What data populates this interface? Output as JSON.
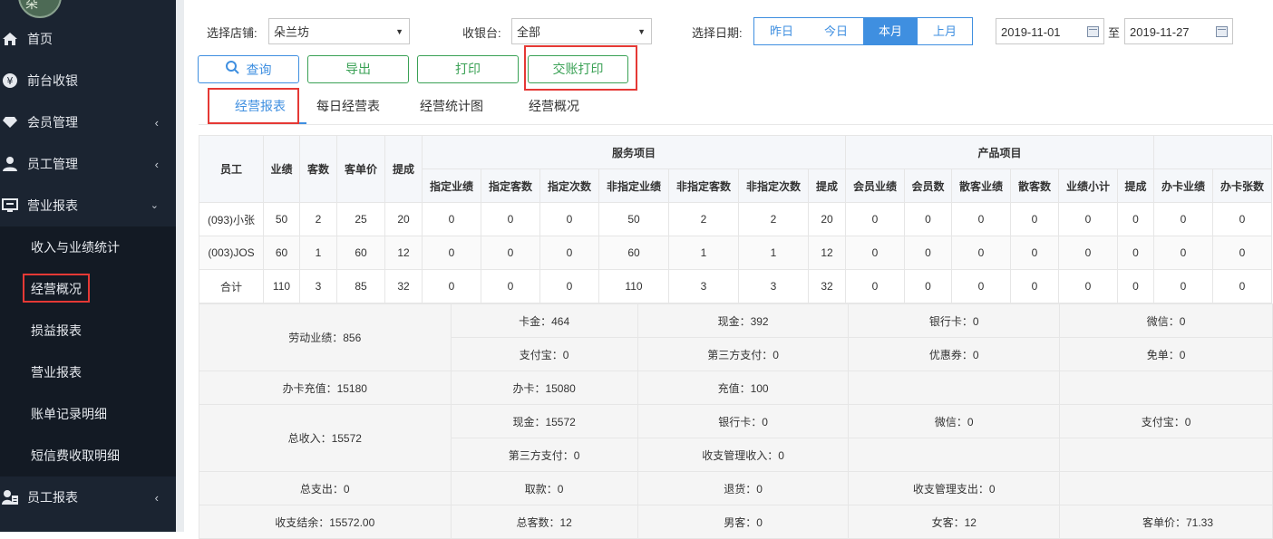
{
  "nav": {
    "items": [
      {
        "label": "首页",
        "icon": "home-icon"
      },
      {
        "label": "前台收银",
        "icon": "yen-icon"
      },
      {
        "label": "会员管理",
        "icon": "diamond-icon"
      },
      {
        "label": "员工管理",
        "icon": "user-icon"
      },
      {
        "label": "营业报表",
        "icon": "monitor-icon"
      },
      {
        "label": "员工报表",
        "icon": "staff-report-icon"
      }
    ],
    "sub_items": [
      "收入与业绩统计",
      "经营概况",
      "损益报表",
      "营业报表",
      "账单记录明细",
      "短信费收取明细"
    ]
  },
  "filters": {
    "store_label": "选择店铺:",
    "store_value": "朵兰坊",
    "cashier_label": "收银台:",
    "cashier_value": "全部",
    "date_label": "选择日期:",
    "ranges": [
      "昨日",
      "今日",
      "本月",
      "上月"
    ],
    "active_range": "本月",
    "start_date": "2019-11-01",
    "to": "至",
    "end_date": "2019-11-27"
  },
  "actions": {
    "query": "查询",
    "export": "导出",
    "print": "打印",
    "shift_print": "交账打印"
  },
  "tabs": [
    "经营报表",
    "每日经营表",
    "经营统计图",
    "经营概况"
  ],
  "table": {
    "headers": {
      "employee": "员工",
      "performance": "业绩",
      "customers": "客数",
      "avg": "客单价",
      "commission": "提成",
      "service_group": "服务项目",
      "product_group": "产品项目",
      "service": [
        "指定业绩",
        "指定客数",
        "指定次数",
        "非指定业绩",
        "非指定客数",
        "非指定次数",
        "提成"
      ],
      "product": [
        "会员业绩",
        "会员数",
        "散客业绩",
        "散客数",
        "业绩小计",
        "提成"
      ],
      "card": [
        "办卡业绩",
        "办卡张数"
      ]
    },
    "rows": [
      [
        "(093)小张",
        "50",
        "2",
        "25",
        "20",
        "0",
        "0",
        "0",
        "50",
        "2",
        "2",
        "20",
        "0",
        "0",
        "0",
        "0",
        "0",
        "0",
        "0",
        "0"
      ],
      [
        "(003)JOS",
        "60",
        "1",
        "60",
        "12",
        "0",
        "0",
        "0",
        "60",
        "1",
        "1",
        "12",
        "0",
        "0",
        "0",
        "0",
        "0",
        "0",
        "0",
        "0"
      ],
      [
        "合计",
        "110",
        "3",
        "85",
        "32",
        "0",
        "0",
        "0",
        "110",
        "3",
        "3",
        "32",
        "0",
        "0",
        "0",
        "0",
        "0",
        "0",
        "0",
        "0"
      ]
    ]
  },
  "summary": {
    "labor": "劳动业绩：856",
    "card_amount": "卡金：464",
    "cash": "现金：392",
    "bank_card": "银行卡：0",
    "wechat": "微信：0",
    "alipay": "支付宝：0",
    "third_party": "第三方支付：0",
    "coupon": "优惠券：0",
    "free": "免单：0",
    "recharge_total": "办卡充值：15180",
    "open_card": "办卡：15080",
    "recharge": "充值：100",
    "income_total": "总收入：15572",
    "inc_cash": "现金：15572",
    "inc_bank": "银行卡：0",
    "inc_wechat": "微信：0",
    "inc_alipay": "支付宝：0",
    "inc_third": "第三方支付：0",
    "inc_mgmt": "收支管理收入：0",
    "expense_total": "总支出：0",
    "withdraw": "取款：0",
    "refund": "退货：0",
    "exp_mgmt": "收支管理支出：0",
    "balance": "收支结余：15572.00",
    "total_customers": "总客数：12",
    "male": "男客：0",
    "female": "女客：12",
    "avg_price": "客单价：71.33"
  }
}
